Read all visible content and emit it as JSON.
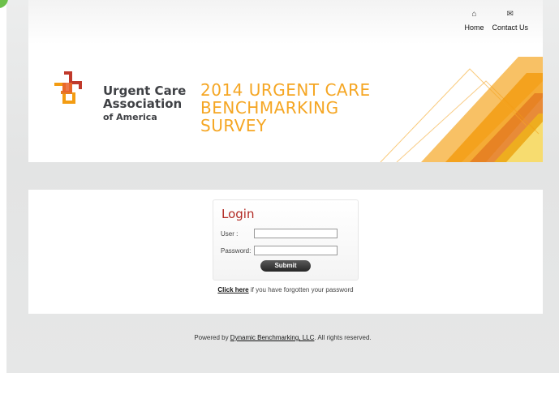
{
  "topnav": {
    "home": {
      "label": "Home",
      "icon": "home-icon"
    },
    "contact": {
      "label": "Contact Us",
      "icon": "mail-icon"
    }
  },
  "brand": {
    "org_line1": "Urgent Care",
    "org_line2": "Association",
    "org_line3": "of America",
    "colors": {
      "logo_red": "#c0392b",
      "logo_orange": "#f39c12",
      "title_orange": "#f5a623"
    }
  },
  "survey_title": {
    "line1": "2014 URGENT CARE",
    "line2": "BENCHMARKING",
    "line3": "SURVEY"
  },
  "login": {
    "title": "Login",
    "user_label": "User :",
    "user_value": "",
    "password_label": "Password:",
    "password_value": "",
    "submit_label": "Submit",
    "forgot_link": "Click here",
    "forgot_text": " if you have forgotten your password"
  },
  "footer": {
    "prefix": "Powered by ",
    "link": "Dynamic Benchmarking, LLC",
    "suffix": ". All rights reserved."
  }
}
